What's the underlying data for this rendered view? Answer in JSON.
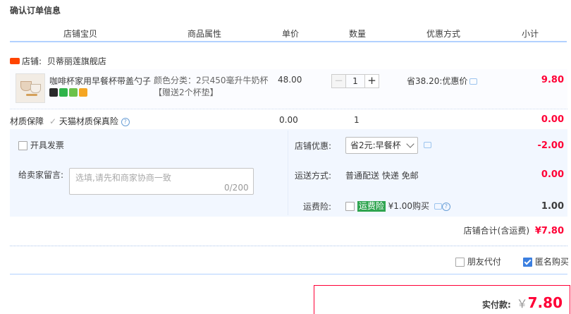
{
  "page": {
    "title": "确认订单信息"
  },
  "columns": [
    "店铺宝贝",
    "商品属性",
    "单价",
    "数量",
    "优惠方式",
    "小计"
  ],
  "shop": {
    "label": "店铺:",
    "name": "贝蒂丽莲旗舰店",
    "badge": "tmall-badge-icon"
  },
  "item": {
    "title": "咖啡杯家用早餐杯带盖勺子",
    "spec": "颜色分类：2只450毫升牛奶杯【赠送2个杯垫】",
    "price": "48.00",
    "quantity": "1",
    "decrease_label": "−",
    "increase_label": "+",
    "promo": "省38.20:优惠价",
    "subtotal": "9.80",
    "service_icons": [
      {
        "name": "tmall-cat-icon",
        "color": "#2a2a2a"
      },
      {
        "name": "seven-day-return-icon",
        "color": "#2fb44a"
      },
      {
        "name": "guarantee-icon",
        "color": "#6cc24a"
      },
      {
        "name": "card-pay-icon",
        "color": "#f5a623"
      }
    ]
  },
  "insurance": {
    "label": "材质保障",
    "option": "天猫材质保真险",
    "price": "0.00",
    "quantity": "1",
    "subtotal": "0.00"
  },
  "invoice": {
    "label": "开具发票",
    "checked": false
  },
  "message": {
    "label": "给卖家留言:",
    "placeholder": "选填,请先和商家协商一致",
    "counter": "0/200"
  },
  "shop_discount": {
    "label": "店铺优惠:",
    "selected": "省2元:早餐杯",
    "amount": "-2.00"
  },
  "shipping": {
    "label": "运送方式:",
    "method": "普通配送 快递 免邮",
    "amount": "0.00"
  },
  "freight_insurance": {
    "label": "运费险:",
    "tag": "运费险",
    "price": "¥1.00购买",
    "amount": "1.00",
    "checked": false
  },
  "shop_total": {
    "label": "店铺合计(含运费)",
    "amount": "¥7.80"
  },
  "options": {
    "friend_pay": "朋友代付",
    "friend_pay_checked": false,
    "anonymous": "匿名购买",
    "anonymous_checked": true
  },
  "payment": {
    "label": "实付款:",
    "currency": "￥",
    "amount": "7.80"
  },
  "colors": {
    "accent_red": "#ff0036",
    "accent_blue": "#b2d1ff",
    "panel_bg": "#f2f7ff"
  }
}
